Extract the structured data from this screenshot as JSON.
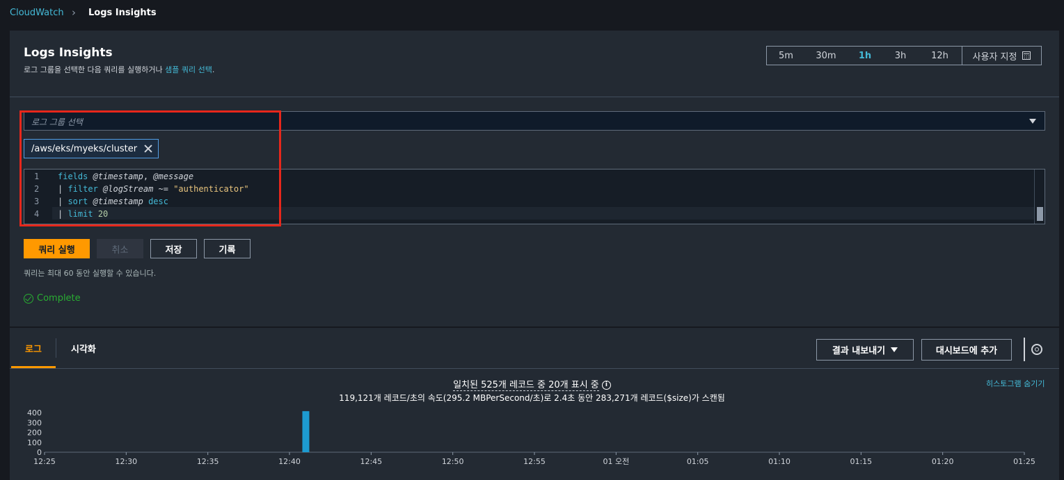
{
  "breadcrumb": {
    "root": "CloudWatch",
    "current": "Logs Insights"
  },
  "header": {
    "title": "Logs Insights",
    "subtitle_prefix": "로그 그룹을 선택한 다음 쿼리를 실행하거나 ",
    "subtitle_link": "샘플 쿼리 선택",
    "subtitle_suffix": "."
  },
  "time_range": {
    "options": [
      "5m",
      "30m",
      "1h",
      "3h",
      "12h"
    ],
    "selected": "1h",
    "custom_label": "사용자 지정",
    "custom_icon": "calendar-icon"
  },
  "log_group_select": {
    "placeholder": "로그 그룹 선택",
    "selected_token": "/aws/eks/myeks/cluster"
  },
  "query": {
    "lines": [
      "fields @timestamp, @message",
      "| filter @logStream ~= \"authenticator\"",
      "| sort @timestamp desc",
      "| limit 20"
    ]
  },
  "actions": {
    "run": "쿼리 실행",
    "cancel": "취소",
    "save": "저장",
    "history": "기록"
  },
  "hint": "쿼리는 최대 60 동안 실행할 수 있습니다.",
  "status": "Complete",
  "results": {
    "tabs": [
      "로그",
      "시각화"
    ],
    "active_tab": "로그",
    "export_label": "결과 내보내기",
    "dashboard_label": "대시보드에 추가",
    "matched_text": "일치된 525개 레코드 중 20개 표시 중",
    "scanned_text": "119,121개 레코드/초의 속도(295.2 MBPerSecond/초)로 2.4초 동안 283,271개 레코드($size)가 스캔됨",
    "hide_histogram": "히스토그램 숨기기"
  },
  "colors": {
    "accent": "#ff9900",
    "link": "#44b9d6",
    "bar": "#1d9bd1",
    "success": "#29ad32"
  },
  "chart_data": {
    "type": "bar",
    "title": "",
    "xlabel": "",
    "ylabel": "",
    "ylim": [
      0,
      400
    ],
    "yticks": [
      "400",
      "300",
      "200",
      "100",
      "0"
    ],
    "xticks": [
      "12:25",
      "12:30",
      "12:35",
      "12:40",
      "12:45",
      "12:50",
      "12:55",
      "01 오전",
      "01:05",
      "01:10",
      "01:15",
      "01:20",
      "01:25"
    ],
    "series": [
      {
        "x": [
          "12:41"
        ],
        "values": [
          415
        ]
      }
    ]
  }
}
